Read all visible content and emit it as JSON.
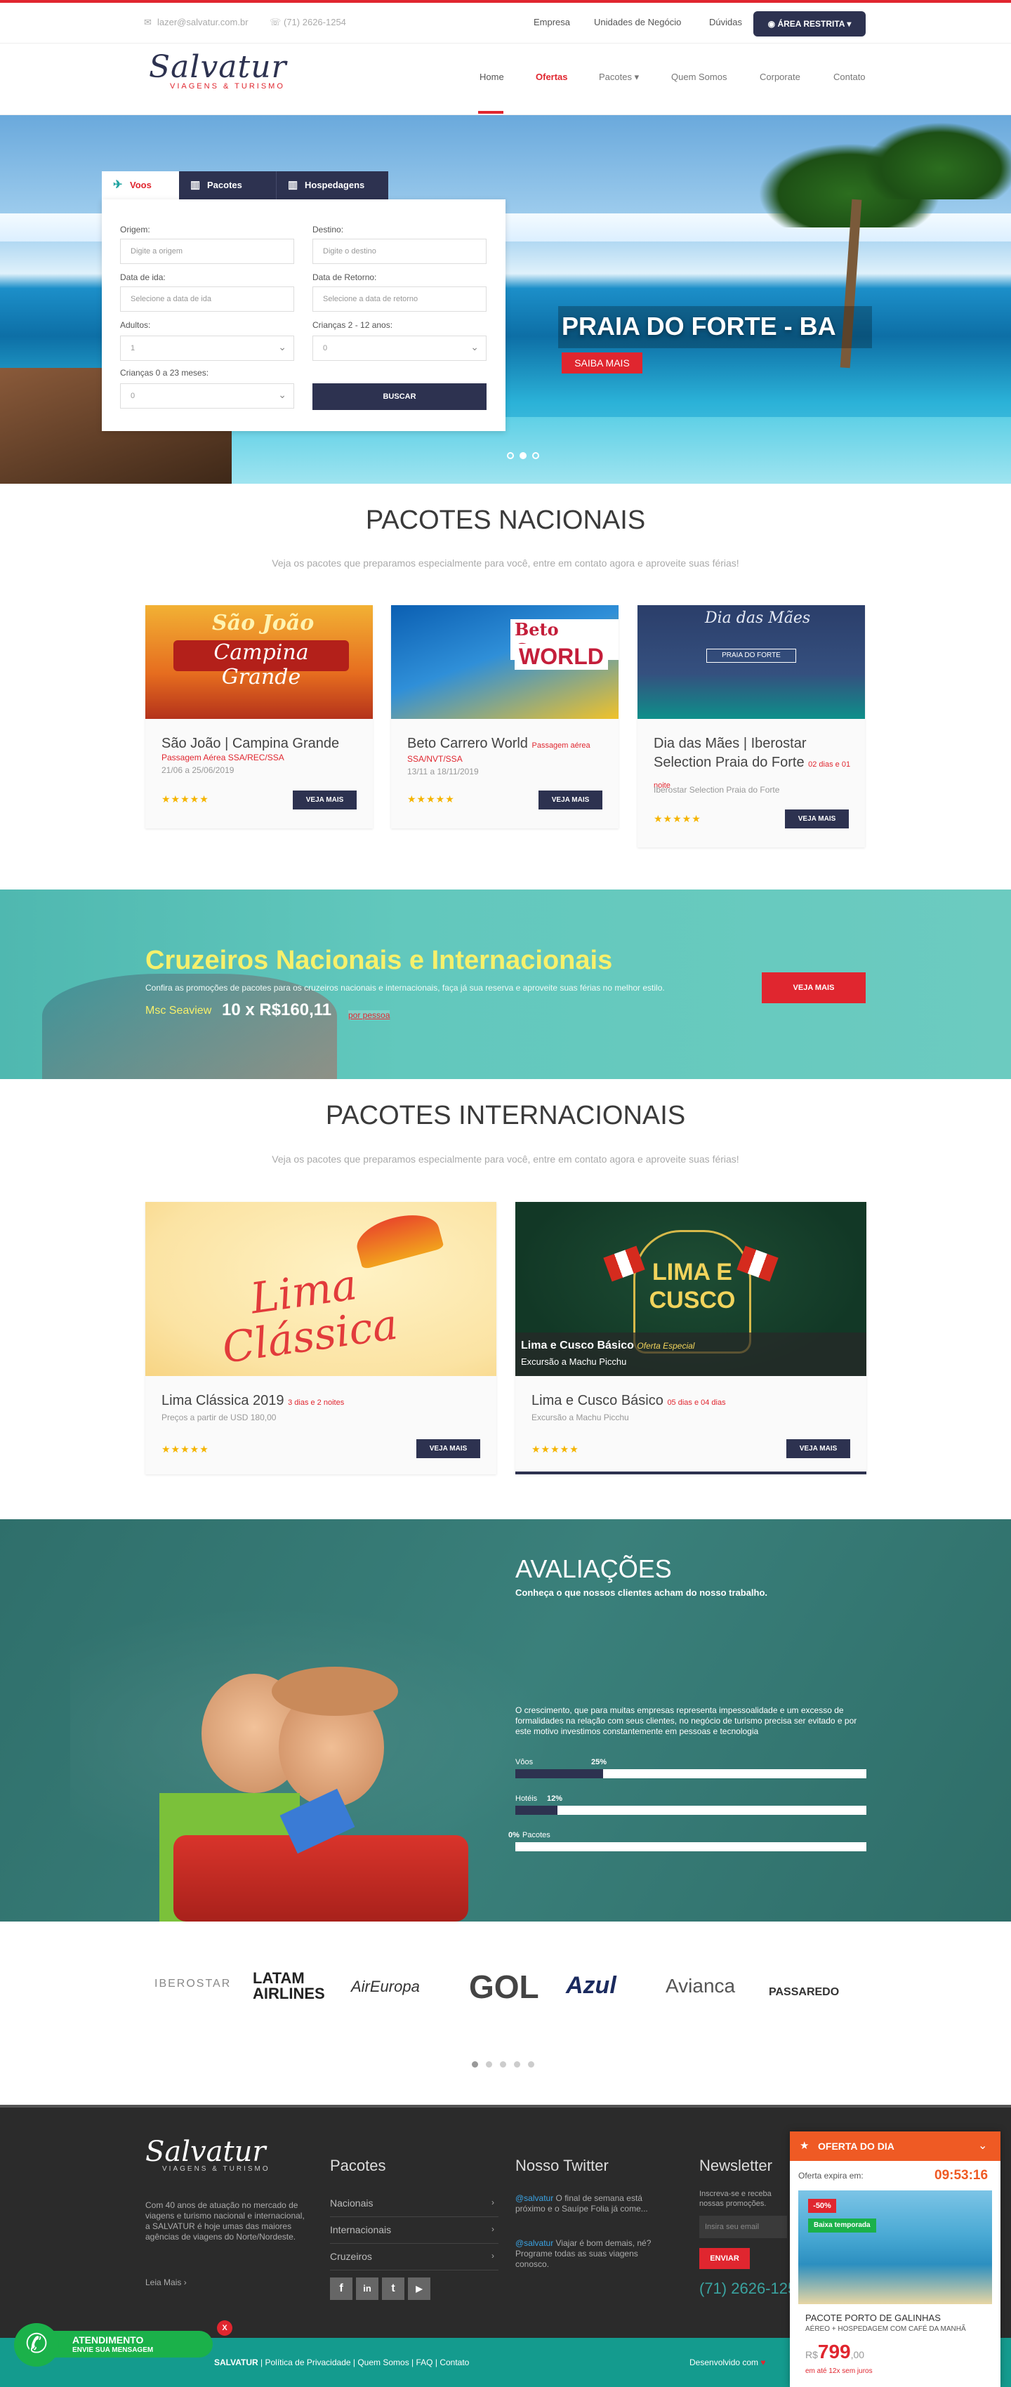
{
  "colors": {
    "accent": "#e0262f",
    "navy": "#2d3250",
    "teal": "#149b8e",
    "cruise_title": "#f7f06b"
  },
  "topbar": {
    "email": "lazer@salvatur.com.br",
    "phone": "(71) 2626-1254",
    "links": [
      "Empresa",
      "Unidades de Negócio",
      "Dúvidas"
    ],
    "area_restrita": "ÁREA RESTRITA"
  },
  "header": {
    "logo_script": "Salvatur",
    "logo_sub": "VIAGENS & TURISMO",
    "nav": [
      "Home",
      "Ofertas",
      "Pacotes",
      "Quem Somos",
      "Corporate",
      "Contato"
    ]
  },
  "hero": {
    "caption": "PRAIA DO FORTE - BA",
    "button": "SAIBA MAIS"
  },
  "search": {
    "tabs": [
      "Voos",
      "Pacotes",
      "Hospedagens"
    ],
    "origem_label": "Origem:",
    "origem_ph": "Digite a origem",
    "destino_label": "Destino:",
    "destino_ph": "Digite o destino",
    "ida_label": "Data de ida:",
    "ida_ph": "Selecione a data de ida",
    "retorno_label": "Data de Retorno:",
    "retorno_ph": "Selecione a data de retorno",
    "adultos_label": "Adultos:",
    "adultos_val": "1",
    "criancas_label": "Crianças 2 - 12 anos:",
    "criancas_val": "0",
    "bebes_label": "Crianças 0 a 23 meses:",
    "bebes_val": "0",
    "buscar": "BUSCAR"
  },
  "nacionais": {
    "title": "PACOTES NACIONAIS",
    "subtitle": "Veja os pacotes que preparamos especialmente para você, entre em contato agora e aproveite suas férias!",
    "cards": [
      {
        "img_title": "São João",
        "img_sub": "Campina Grande",
        "title": "São João | Campina Grande",
        "tag": "Passagem Aérea SSA/REC/SSA",
        "tag_inline": "",
        "dates": "21/06 a 25/06/2019",
        "stars": "★★★★★",
        "button": "VEJA MAIS"
      },
      {
        "img_title": "Beto Carrero",
        "img_sub": "WORLD",
        "title": "Beto Carrero World",
        "tag": "SSA/NVT/SSA",
        "tag_inline": "Passagem aérea",
        "dates": "13/11 a 18/11/2019",
        "stars": "★★★★★",
        "button": "VEJA MAIS"
      },
      {
        "img_title": "Dia das Mães",
        "img_sub": "PRAIA DO FORTE",
        "title": "Dia das Mães | Iberostar Selection Praia do Forte",
        "tag": "",
        "tag_inline": "02 dias e 01 noite",
        "dates": "Iberostar Selection Praia do Forte",
        "stars": "★★★★★",
        "button": "VEJA MAIS"
      }
    ]
  },
  "cruise": {
    "title": "Cruzeiros Nacionais e Internacionais",
    "text": "Confira as promoções de pacotes para os cruzeiros nacionais e internacionais, faça já sua reserva e aproveite suas férias no melhor estilo.",
    "ship": "Msc Seaview",
    "price": "10 x R$160,11",
    "per": "por pessoa",
    "button": "VEJA MAIS"
  },
  "internacionais": {
    "title": "PACOTES INTERNACIONAIS",
    "subtitle": "Veja os pacotes que preparamos especialmente para você, entre em contato agora e aproveite suas férias!",
    "cards": [
      {
        "img_title": "Lima Clássica",
        "overlay": "",
        "overlay_tag": "",
        "overlay_sub": "",
        "title": "Lima Clássica 2019",
        "tag": "3 dias e 2 noites",
        "desc": "Preços a partir de USD 180,00",
        "stars": "★★★★★",
        "button": "VEJA MAIS"
      },
      {
        "img_title": "LIMA E CUSCO",
        "overlay": "Lima e Cusco Básico",
        "overlay_tag": "Oferta Especial",
        "overlay_sub": "Excursão a Machu Picchu",
        "title": "Lima e Cusco Básico",
        "tag": "05 dias e 04 dias",
        "desc": "Excursão a Machu Picchu",
        "stars": "★★★★★",
        "button": "VEJA MAIS"
      }
    ]
  },
  "reviews": {
    "title": "AVALIAÇÕES",
    "subtitle": "Conheça o que nossos clientes acham do nosso trabalho.",
    "text": "O crescimento, que para muitas empresas representa impessoalidade e um excesso de formalidades na relação com seus clientes, no negócio de turismo precisa ser evitado e por este motivo investimos constantemente em pessoas e tecnologia",
    "bars": [
      {
        "label": "Vôos",
        "pct": "25%",
        "value": 0.25
      },
      {
        "label": "Hotéis",
        "pct": "12%",
        "value": 0.12
      },
      {
        "label": "Pacotes",
        "pct": "0%",
        "value": 0
      }
    ]
  },
  "partners": [
    "IBEROSTAR",
    "LATAM AIRLINES",
    "AirEuropa",
    "GOL",
    "Azul",
    "Avianca",
    "PASSAREDO"
  ],
  "footer": {
    "about": "Com 40 anos de atuação no mercado de viagens e turismo nacional e internacional, a SALVATUR é hoje umas das maiores agências de viagens do Norte/Nordeste.",
    "leia_mais": "Leia Mais",
    "pacotes_title": "Pacotes",
    "pacotes": [
      "Nacionais",
      "Internacionais",
      "Cruzeiros"
    ],
    "twitter_title": "Nosso Twitter",
    "tweet1_user": "@salvatur",
    "tweet1": "O final de semana está próximo e o Sauípe Folia já come...",
    "tweet2_user": "@salvatur",
    "tweet2": "Viajar é bom demais, né? Programe todas as suas viagens conosco.",
    "newsletter_title": "Newsletter",
    "newsletter_text": "Inscreva-se e receba nossas promoções.",
    "newsletter_ph": "Insira seu email",
    "enviar": "ENVIAR",
    "phone": "(71) 2626-1254"
  },
  "copyright": {
    "brand": "SALVATUR",
    "links": [
      "Política de Privacidade",
      "Quem Somos",
      "FAQ",
      "Contato"
    ],
    "dev": "Desenvolvido com"
  },
  "oferta": {
    "header": "OFERTA DO DIA",
    "expira_label": "Oferta expira em:",
    "timer": "09:53:16",
    "badge": "-50%",
    "season": "Baixa temporada",
    "title": "PACOTE PORTO DE GALINHAS",
    "desc": "AÉREO + HOSPEDAGEM COM CAFÉ DA MANHÃ",
    "currency": "R$",
    "price": "799",
    "cents": ",00",
    "installments": "em até 12x sem juros"
  },
  "whatsapp": {
    "title": "ATENDIMENTO",
    "sub": "ENVIE SUA MENSAGEM",
    "close": "X"
  }
}
